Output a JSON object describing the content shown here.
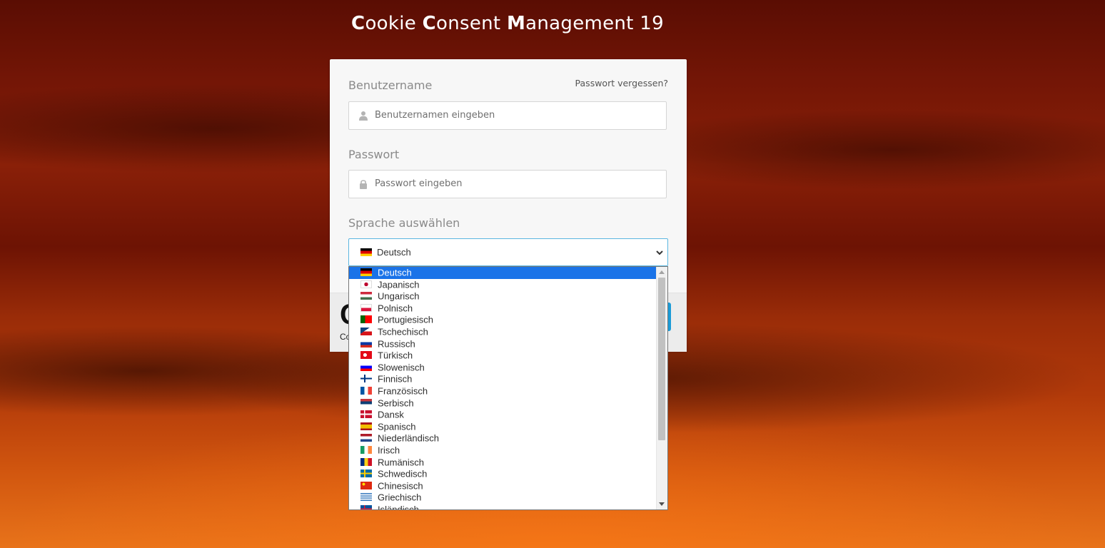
{
  "app_title": {
    "parts": [
      {
        "bold": "C",
        "rest": "ookie "
      },
      {
        "bold": "C",
        "rest": "onsent "
      },
      {
        "bold": "M",
        "rest": "anagement 19"
      }
    ]
  },
  "login": {
    "username_label": "Benutzername",
    "forgot_password_link": "Passwort vergessen?",
    "username_placeholder": "Benutzernamen eingeben",
    "password_label": "Passwort",
    "password_placeholder": "Passwort eingeben",
    "language_label": "Sprache auswählen",
    "language_selected": "Deutsch",
    "footer_logo_glyph": "C",
    "footer_logo_text": "Co"
  },
  "language_options": [
    {
      "label": "Deutsch",
      "flag": "de",
      "selected": true
    },
    {
      "label": "Japanisch",
      "flag": "jp"
    },
    {
      "label": "Ungarisch",
      "flag": "hu"
    },
    {
      "label": "Polnisch",
      "flag": "pl"
    },
    {
      "label": "Portugiesisch",
      "flag": "pt"
    },
    {
      "label": "Tschechisch",
      "flag": "cz"
    },
    {
      "label": "Russisch",
      "flag": "ru"
    },
    {
      "label": "Türkisch",
      "flag": "tr"
    },
    {
      "label": "Slowenisch",
      "flag": "si"
    },
    {
      "label": "Finnisch",
      "flag": "fi"
    },
    {
      "label": "Französisch",
      "flag": "fr"
    },
    {
      "label": "Serbisch",
      "flag": "rs"
    },
    {
      "label": "Dansk",
      "flag": "dk"
    },
    {
      "label": "Spanisch",
      "flag": "es"
    },
    {
      "label": "Niederländisch",
      "flag": "nl"
    },
    {
      "label": "Irisch",
      "flag": "ie"
    },
    {
      "label": "Rumänisch",
      "flag": "ro"
    },
    {
      "label": "Schwedisch",
      "flag": "se"
    },
    {
      "label": "Chinesisch",
      "flag": "cn"
    },
    {
      "label": "Griechisch",
      "flag": "gr"
    },
    {
      "label": "Isländisch",
      "flag": "is"
    }
  ],
  "colors": {
    "accent": "#1a9bd7",
    "selected_option": "#1a73e8",
    "select_focus_border": "#5bb6e0"
  },
  "icons": {
    "username": "user-icon",
    "password": "lock-icon",
    "select": "chevron-down-icon"
  }
}
